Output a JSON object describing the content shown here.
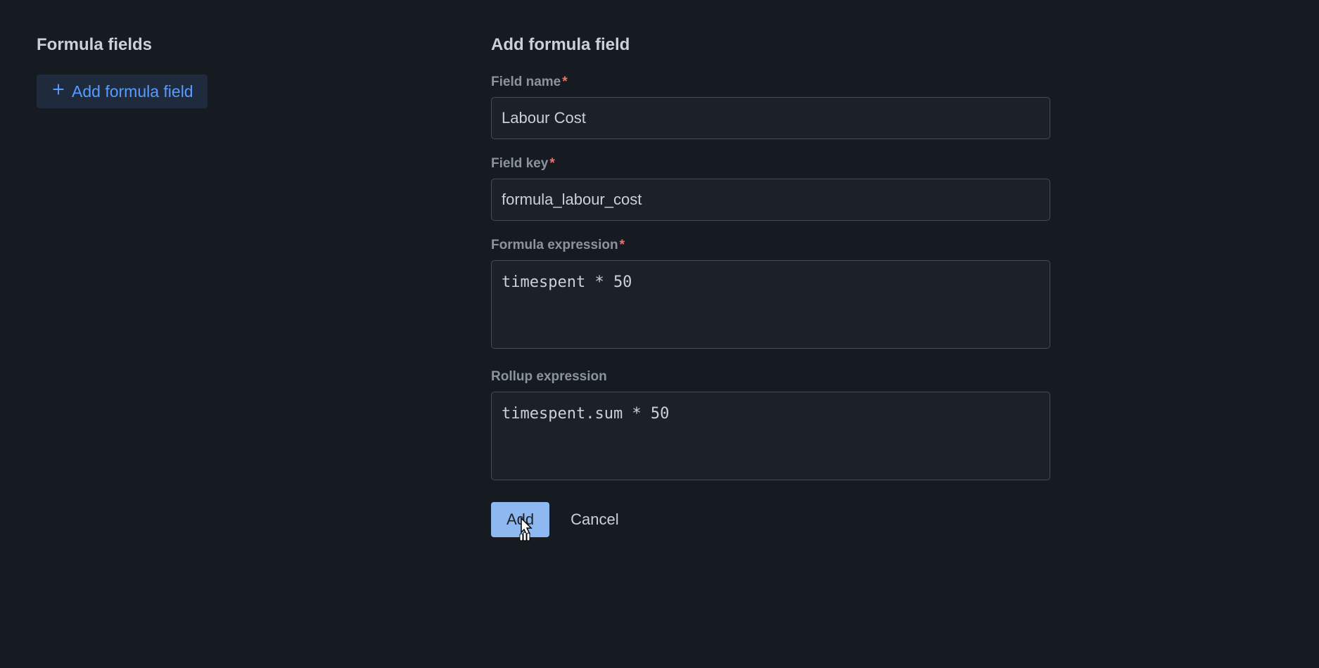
{
  "left": {
    "title": "Formula fields",
    "addButton": "Add formula field"
  },
  "form": {
    "title": "Add formula field",
    "fieldName": {
      "label": "Field name",
      "required": true,
      "value": "Labour Cost"
    },
    "fieldKey": {
      "label": "Field key",
      "required": true,
      "value": "formula_labour_cost"
    },
    "formulaExpression": {
      "label": "Formula expression",
      "required": true,
      "value": "timespent * 50"
    },
    "rollupExpression": {
      "label": "Rollup expression",
      "required": false,
      "value": "timespent.sum * 50"
    },
    "submitLabel": "Add",
    "cancelLabel": "Cancel"
  }
}
